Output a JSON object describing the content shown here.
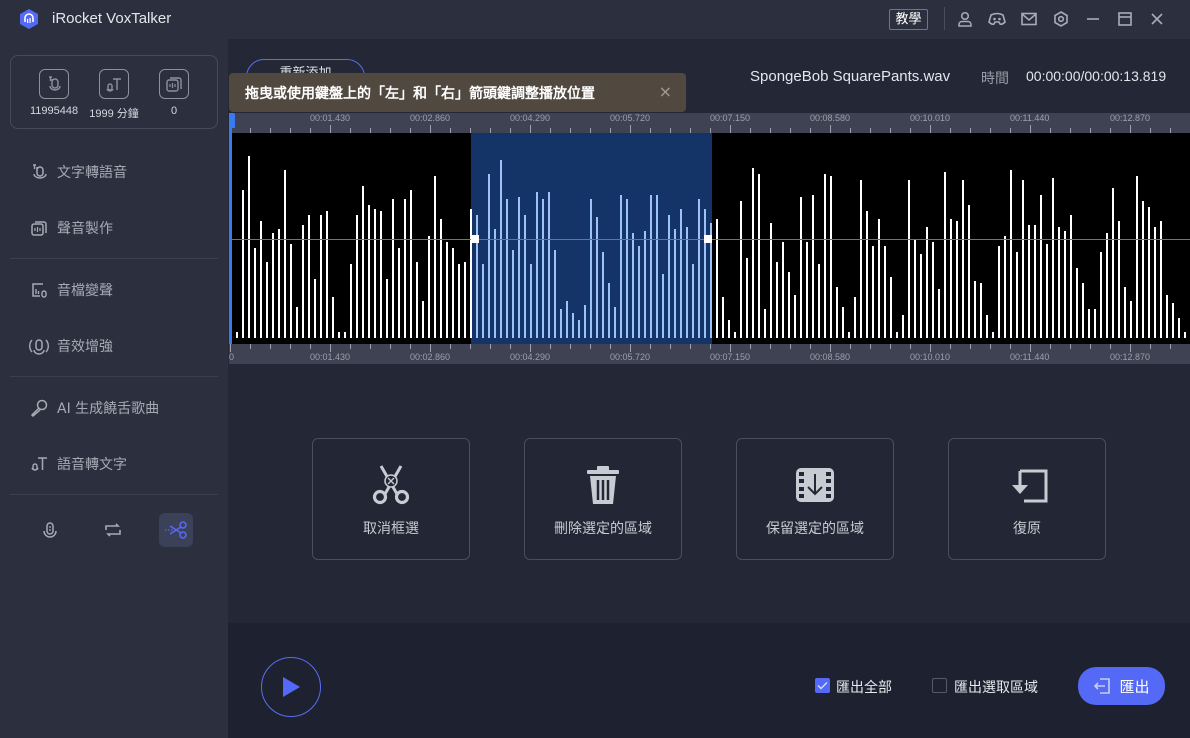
{
  "app": {
    "title": "iRocket VoxTalker",
    "tutorial_label": "教學",
    "titlebar_icons": [
      "user-icon",
      "discord-icon",
      "mail-icon",
      "settings-icon",
      "minimize-icon",
      "maximize-icon",
      "close-icon"
    ]
  },
  "sidebar": {
    "stats": [
      {
        "icon": "text-to-speech-icon",
        "value": "11995448"
      },
      {
        "icon": "speech-to-text-icon",
        "value": "1999 分鐘"
      },
      {
        "icon": "voice-clone-icon",
        "value": "0"
      }
    ],
    "items": [
      {
        "icon": "text-to-speech-icon",
        "label": "文字轉語音"
      },
      {
        "icon": "voice-clone-icon",
        "label": "聲音製作"
      },
      {
        "icon": "voice-changer-icon",
        "label": "音檔變聲"
      },
      {
        "icon": "audio-enhance-icon",
        "label": "音效增強"
      },
      {
        "icon": "microphone-icon",
        "label": "AI 生成饒舌歌曲"
      },
      {
        "icon": "speech-to-text-icon",
        "label": "語音轉文字"
      }
    ],
    "bottom_tools": [
      {
        "icon": "recorder-icon",
        "active": false
      },
      {
        "icon": "convert-icon",
        "active": false
      },
      {
        "icon": "scissors-icon",
        "active": true
      }
    ],
    "accent": "#5469f5"
  },
  "editor": {
    "readd_label": "重新添加",
    "filename": "SpongeBob SquarePants.wav",
    "time_label": "時間",
    "time_value": "00:00:00/00:00:13.819",
    "tooltip": "拖曳或使用鍵盤上的「左」和「右」箭頭鍵調整播放位置",
    "tooltip_close": "×",
    "ruler_labels": [
      "00:01.430",
      "00:02.860",
      "00:04.290",
      "00:05.720",
      "00:07.150",
      "00:08.580",
      "00:10.010",
      "00:11.440",
      "00:12.870"
    ],
    "ruler_start_label": "0",
    "duration_seconds": 13.819,
    "selection": {
      "start_seconds": 3.44,
      "end_seconds": 6.89
    },
    "playhead_seconds": 0,
    "waveform_amplitudes": [
      0.03,
      0.03,
      0.72,
      0.89,
      0.44,
      0.57,
      0.37,
      0.51,
      0.53,
      0.82,
      0.46,
      0.15,
      0.55,
      0.6,
      0.29,
      0.6,
      0.62,
      0.2,
      0.03,
      0.03,
      0.36,
      0.6,
      0.74,
      0.65,
      0.63,
      0.62,
      0.29,
      0.68,
      0.44,
      0.68,
      0.72,
      0.37,
      0.18,
      0.5,
      0.79,
      0.58,
      0.47,
      0.44,
      0.36,
      0.37,
      0.63,
      0.6,
      0.36,
      0.8,
      0.53,
      0.87,
      0.68,
      0.43,
      0.69,
      0.6,
      0.36,
      0.71,
      0.68,
      0.71,
      0.43,
      0.14,
      0.18,
      0.12,
      0.09,
      0.16,
      0.68,
      0.59,
      0.42,
      0.27,
      0.15,
      0.7,
      0.68,
      0.51,
      0.45,
      0.52,
      0.7,
      0.7,
      0.31,
      0.6,
      0.53,
      0.63,
      0.54,
      0.36,
      0.68,
      0.63,
      0.56,
      0.58,
      0.2,
      0.09,
      0.03,
      0.67,
      0.39,
      0.83,
      0.8,
      0.14,
      0.56,
      0.37,
      0.47,
      0.32,
      0.21,
      0.69,
      0.47,
      0.7,
      0.36,
      0.8,
      0.79,
      0.25,
      0.15,
      0.03,
      0.2,
      0.77,
      0.62,
      0.45,
      0.58,
      0.45,
      0.3,
      0.03,
      0.11,
      0.77,
      0.48,
      0.41,
      0.54,
      0.47,
      0.24,
      0.81,
      0.58,
      0.57,
      0.77,
      0.65,
      0.28,
      0.27,
      0.11,
      0.03,
      0.45,
      0.5,
      0.82,
      0.42,
      0.77,
      0.55,
      0.55,
      0.7,
      0.46,
      0.78,
      0.54,
      0.52,
      0.6,
      0.34,
      0.27,
      0.14,
      0.14,
      0.42,
      0.51,
      0.73,
      0.57,
      0.25,
      0.18,
      0.79,
      0.67,
      0.64,
      0.54,
      0.57,
      0.21,
      0.17,
      0.1,
      0.03,
      0.03
    ]
  },
  "actions": [
    {
      "icon": "cancel-selection-icon",
      "label": "取消框選"
    },
    {
      "icon": "trash-icon",
      "label": "刪除選定的區域"
    },
    {
      "icon": "keep-region-icon",
      "label": "保留選定的區域"
    },
    {
      "icon": "undo-icon",
      "label": "復原"
    }
  ],
  "footer": {
    "export_all_label": "匯出全部",
    "export_all_checked": true,
    "export_selection_label": "匯出選取區域",
    "export_selection_checked": false,
    "export_label": "匯出"
  }
}
